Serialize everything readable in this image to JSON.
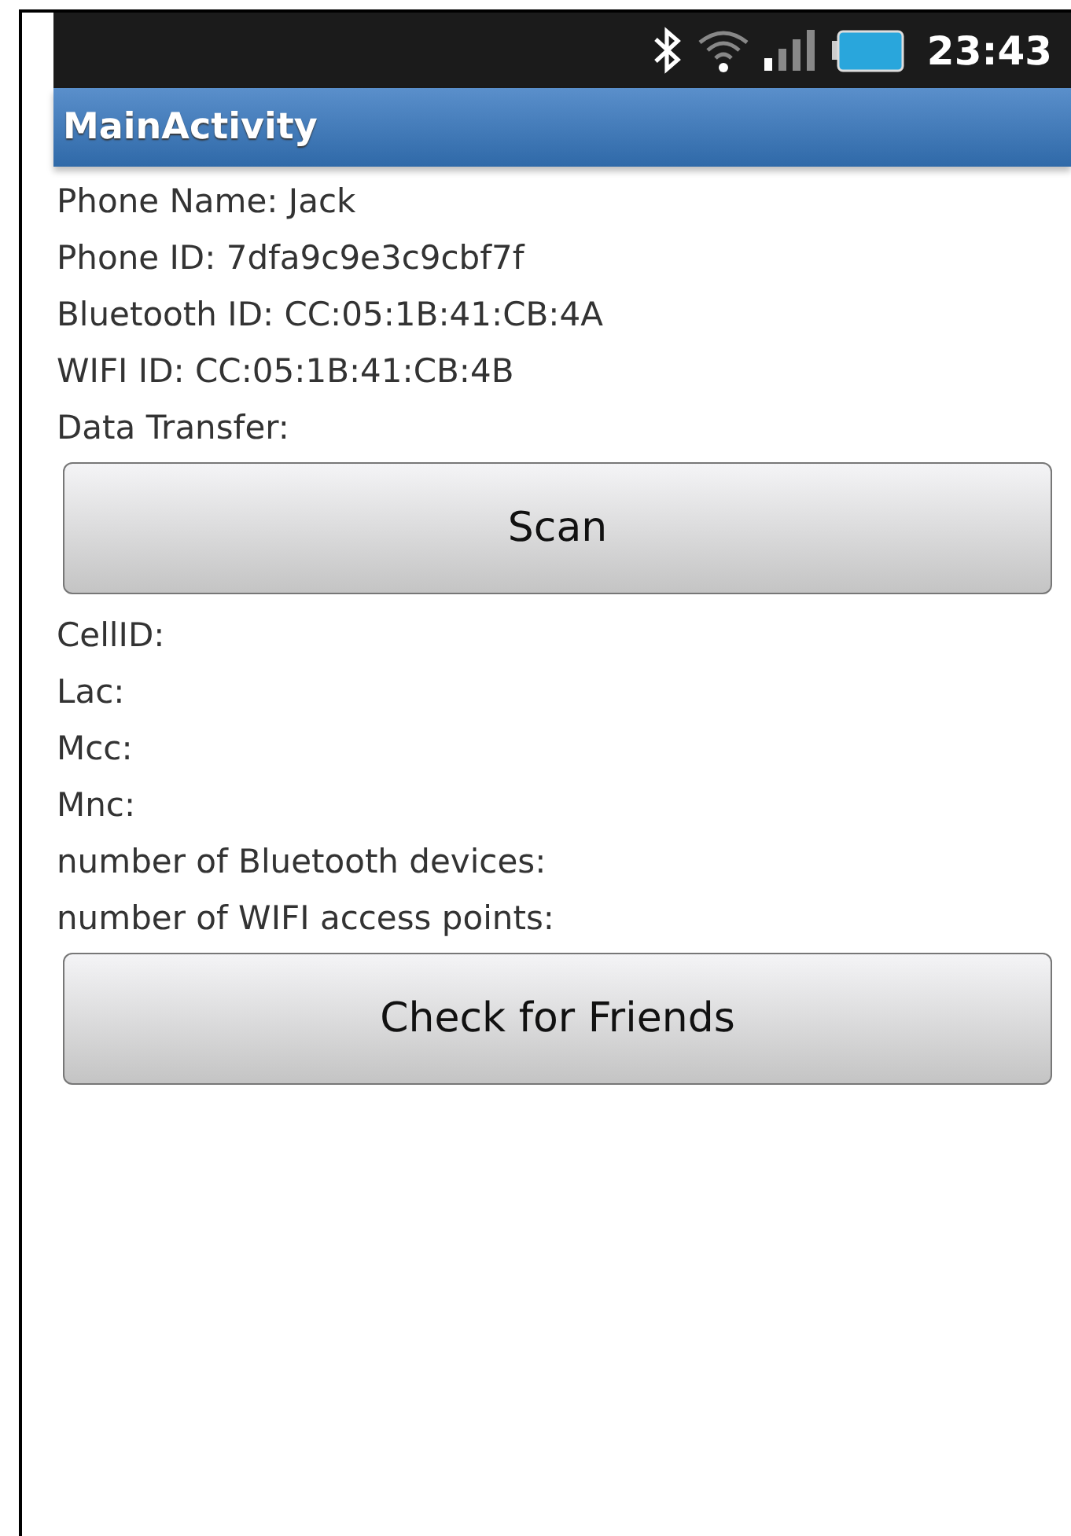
{
  "status_bar": {
    "time": "23:43"
  },
  "title_bar": {
    "title": "MainActivity"
  },
  "content": [
    {
      "kind": "text",
      "text": "Phone Name: Jack"
    },
    {
      "kind": "text",
      "text": "Phone ID: 7dfa9c9e3c9cbf7f"
    },
    {
      "kind": "text",
      "text": "Bluetooth ID: CC:05:1B:41:CB:4A"
    },
    {
      "kind": "text",
      "text": "WIFI ID: CC:05:1B:41:CB:4B"
    },
    {
      "kind": "text",
      "text": "Data Transfer:"
    },
    {
      "kind": "button",
      "text": "Scan"
    },
    {
      "kind": "text",
      "text": "CellID:"
    },
    {
      "kind": "text",
      "text": "Lac:"
    },
    {
      "kind": "text",
      "text": "Mcc:"
    },
    {
      "kind": "text",
      "text": "Mnc:"
    },
    {
      "kind": "text",
      "text": "number of Bluetooth devices:"
    },
    {
      "kind": "text",
      "text": "number of WIFI access points:"
    },
    {
      "kind": "button",
      "text": "Check for Friends"
    }
  ]
}
